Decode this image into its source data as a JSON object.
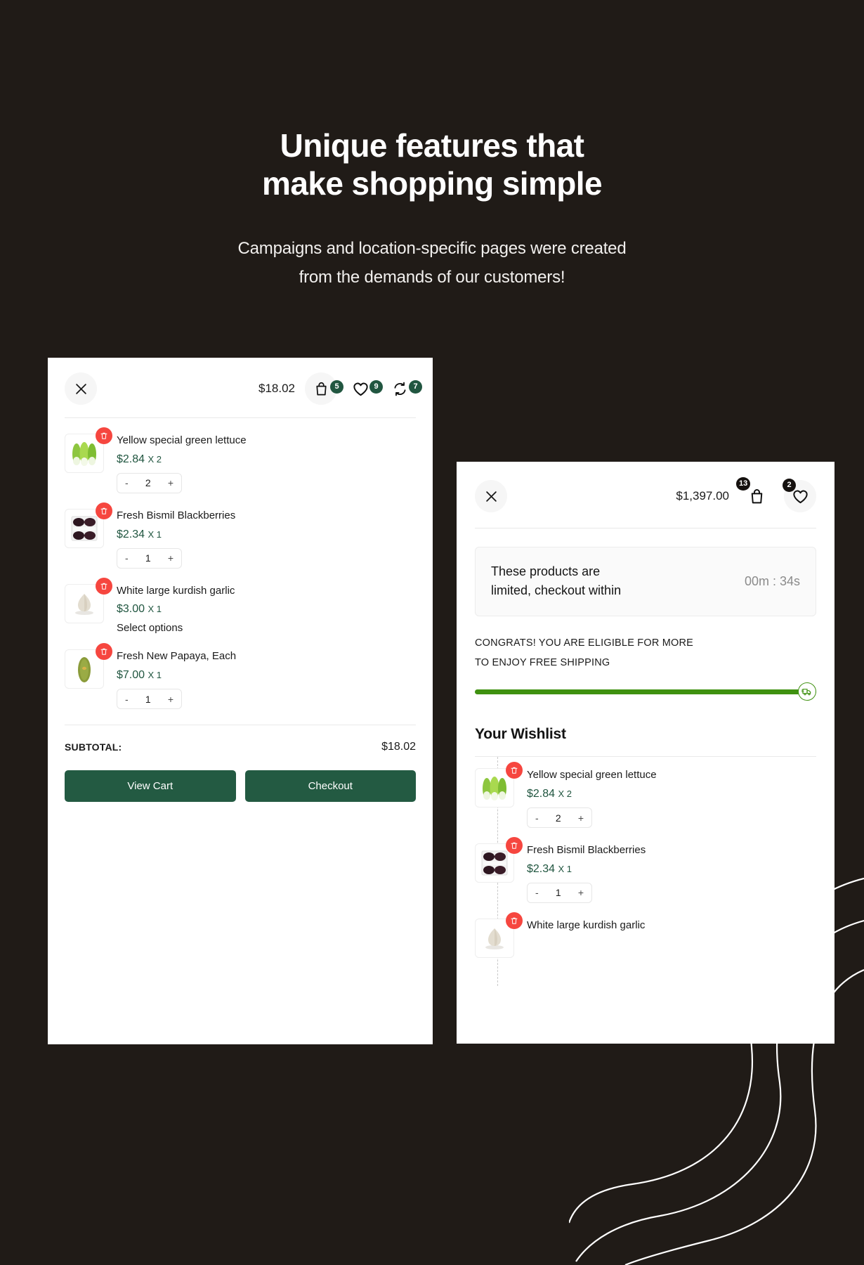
{
  "theme": {
    "background": "#201b17",
    "brand_green": "#235a42",
    "accent_green": "#3f9110",
    "delete_red": "#f6463f",
    "badge_dark": "#15110f"
  },
  "hero": {
    "title_line1": "Unique features that",
    "title_line2": "make shopping simple",
    "sub_line1": "Campaigns and location-specific pages were created",
    "sub_line2": "from the demands of our customers!"
  },
  "cart_panel": {
    "close_label": "close-icon",
    "amount": "$18.02",
    "icons": [
      {
        "name": "shopping-bag-icon",
        "badge": "5"
      },
      {
        "name": "heart-icon",
        "badge": "9"
      },
      {
        "name": "compare-icon",
        "badge": "7"
      }
    ],
    "items": [
      {
        "name": "Yellow special green lettuce",
        "price": "$2.84",
        "mult": "X 2",
        "qty": "2",
        "has_stepper": true,
        "note": "",
        "thumb": "lettuce"
      },
      {
        "name": "Fresh Bismil Blackberries",
        "price": "$2.34",
        "mult": "X 1",
        "qty": "1",
        "has_stepper": true,
        "note": "",
        "thumb": "blackberries"
      },
      {
        "name": "White large kurdish garlic",
        "price": "$3.00",
        "mult": "X 1",
        "qty": "1",
        "has_stepper": false,
        "note": "Select options",
        "thumb": "garlic"
      },
      {
        "name": "Fresh New Papaya, Each",
        "price": "$7.00",
        "mult": "X 1",
        "qty": "1",
        "has_stepper": true,
        "note": "",
        "thumb": "papaya"
      }
    ],
    "subtotal_label": "SUBTOTAL:",
    "subtotal_value": "$18.02",
    "view_cart_label": "View Cart",
    "checkout_label": "Checkout",
    "stepper_minus": "-",
    "stepper_plus": "+"
  },
  "wishlist_panel": {
    "close_label": "close-icon",
    "amount": "$1,397.00",
    "icons": [
      {
        "name": "shopping-bag-icon",
        "badge": "13"
      },
      {
        "name": "heart-icon",
        "badge": "2"
      }
    ],
    "countdown": {
      "text_line1": "These products are",
      "text_line2": "limited, checkout within",
      "timer": "00m : 34s"
    },
    "shipping": {
      "line1": "CONGRATS! YOU ARE ELIGIBLE FOR MORE",
      "line2": "TO ENJOY FREE SHIPPING",
      "progress_percent": 100,
      "truck_icon": "delivery-truck-icon"
    },
    "wishlist_title": "Your Wishlist",
    "items": [
      {
        "name": "Yellow special green lettuce",
        "price": "$2.84",
        "mult": "X 2",
        "qty": "2",
        "has_stepper": true,
        "thumb": "lettuce"
      },
      {
        "name": "Fresh Bismil Blackberries",
        "price": "$2.34",
        "mult": "X 1",
        "qty": "1",
        "has_stepper": true,
        "thumb": "blackberries"
      },
      {
        "name": "White large kurdish garlic",
        "price": "",
        "mult": "",
        "qty": "",
        "has_stepper": false,
        "thumb": "garlic"
      }
    ],
    "stepper_minus": "-",
    "stepper_plus": "+"
  }
}
